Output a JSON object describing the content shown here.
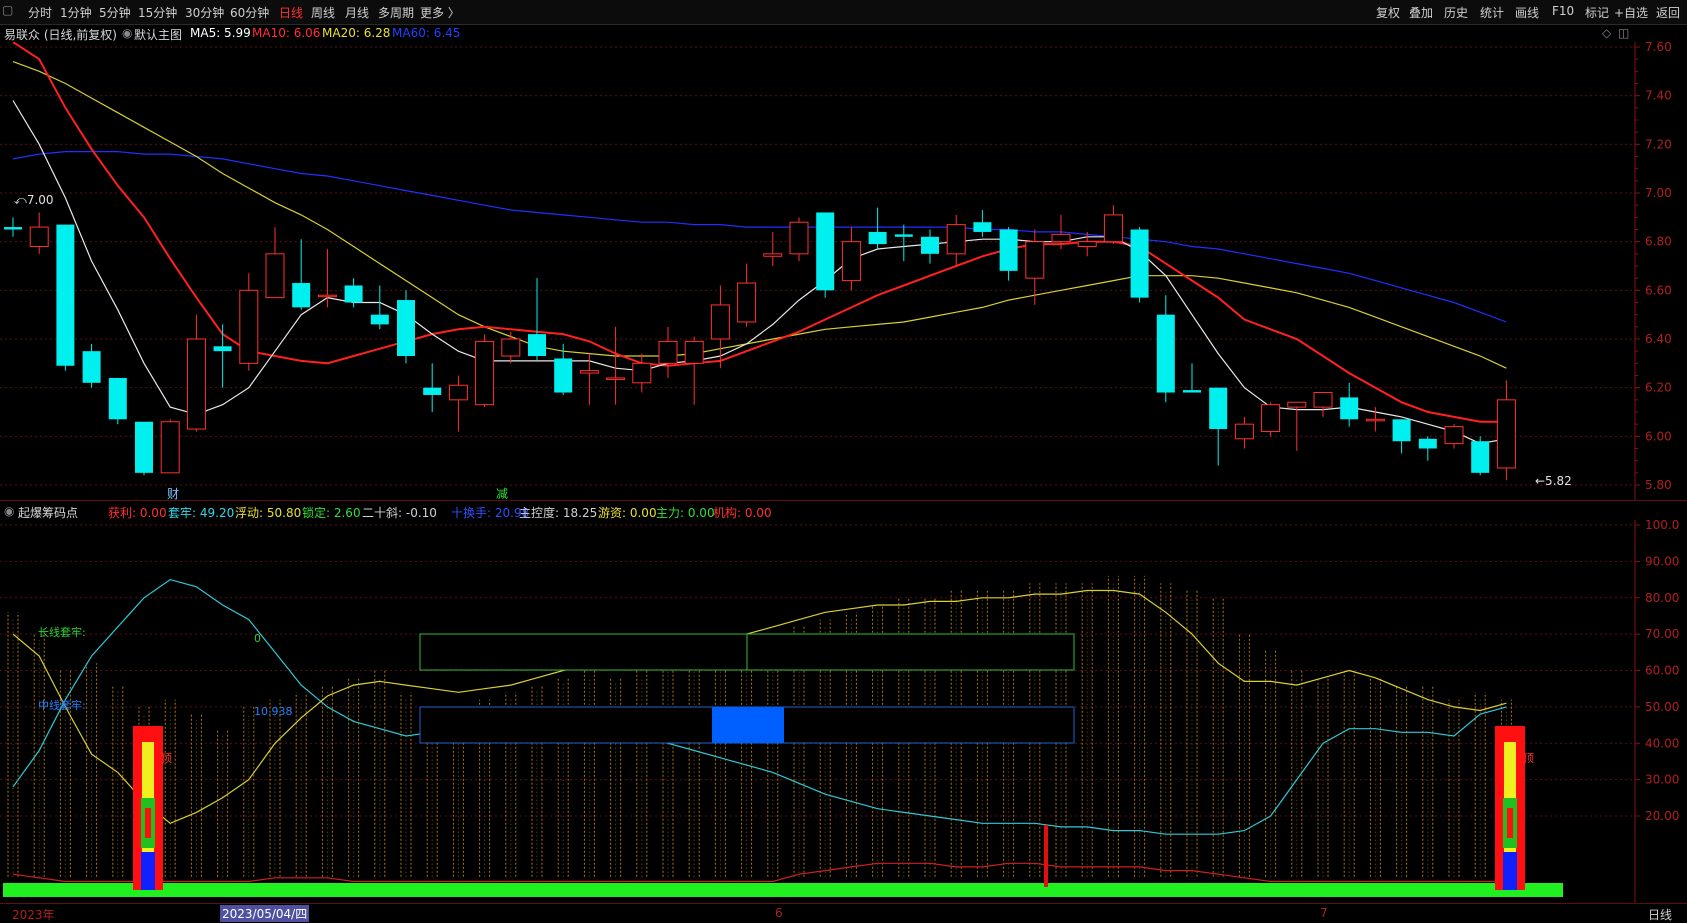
{
  "toolbar": {
    "left_items": [
      "分时",
      "1分钟",
      "5分钟",
      "15分钟",
      "30分钟",
      "60分钟",
      "日线",
      "周线",
      "月线",
      "多周期",
      "更多 〉"
    ],
    "active": "日线",
    "right_items": [
      "复权",
      "叠加",
      "历史",
      "统计",
      "画线",
      "F10",
      "标记",
      "+自选",
      "返回"
    ]
  },
  "main_info": {
    "stock": "易联众 (日线,前复权)",
    "template": "默认主图",
    "ma5": "MA5: 5.99",
    "ma10": "MA10: 6.06",
    "ma20": "MA20: 6.28",
    "ma60": "MA60: 6.45"
  },
  "sub_info": {
    "name": "起爆筹码点",
    "items": [
      {
        "text": "获利: 0.00",
        "color": "#ff3030"
      },
      {
        "text": "套牢: 49.20",
        "color": "#30d8e8"
      },
      {
        "text": "浮动: 50.80",
        "color": "#e8e030"
      },
      {
        "text": "锁定: 2.60",
        "color": "#30e030"
      },
      {
        "text": "二十斜: -0.10",
        "color": "#d0d0d0"
      },
      {
        "text": "十换手: 20.98",
        "color": "#3050ff"
      },
      {
        "text": "主控度: 18.25",
        "color": "#d0d0d0"
      },
      {
        "text": "游资: 0.00",
        "color": "#e8e030"
      },
      {
        "text": "主力: 0.00",
        "color": "#30e030"
      },
      {
        "text": "机构: 0.00",
        "color": "#ff3030"
      }
    ],
    "long_label": "长线套牢:",
    "long_value": "0",
    "mid_label": "中线套牢:",
    "mid_value": "10.938"
  },
  "price_axis": [
    "7.60",
    "7.40",
    "7.20",
    "7.00",
    "6.80",
    "6.60",
    "6.40",
    "6.20",
    "6.00",
    "5.80"
  ],
  "sub_axis": [
    "100.0",
    "90.00",
    "80.00",
    "70.00",
    "60.00",
    "50.00",
    "40.00",
    "30.00",
    "20.00"
  ],
  "annotations": {
    "high": "7.00",
    "low": "5.82",
    "event1": "财",
    "event2": "减",
    "sig1": "顶",
    "sig2": "顶"
  },
  "bottom": {
    "year": "2023年",
    "date": "2023/05/04/四",
    "m6": "6",
    "m7": "7",
    "period": "日线"
  },
  "colors": {
    "up": "#ff3030",
    "down": "#00f0f0",
    "ma5": "#ffffff",
    "ma10": "#ff2020",
    "ma20": "#e0e030",
    "ma60": "#2030ff"
  },
  "chart_data": {
    "type": "candlestick",
    "ylim": [
      5.75,
      7.65
    ],
    "candles": [
      {
        "o": 6.86,
        "h": 6.9,
        "l": 6.82,
        "c": 6.85
      },
      {
        "o": 6.78,
        "h": 6.92,
        "l": 6.75,
        "c": 6.86
      },
      {
        "o": 6.87,
        "h": 6.87,
        "l": 6.27,
        "c": 6.29
      },
      {
        "o": 6.35,
        "h": 6.38,
        "l": 6.2,
        "c": 6.22
      },
      {
        "o": 6.24,
        "h": 6.24,
        "l": 6.05,
        "c": 6.07
      },
      {
        "o": 6.06,
        "h": 6.06,
        "l": 5.84,
        "c": 5.85
      },
      {
        "o": 5.85,
        "h": 6.07,
        "l": 5.85,
        "c": 6.06
      },
      {
        "o": 6.03,
        "h": 6.5,
        "l": 6.02,
        "c": 6.4
      },
      {
        "o": 6.37,
        "h": 6.46,
        "l": 6.2,
        "c": 6.35
      },
      {
        "o": 6.3,
        "h": 6.67,
        "l": 6.27,
        "c": 6.6
      },
      {
        "o": 6.57,
        "h": 6.86,
        "l": 6.57,
        "c": 6.75
      },
      {
        "o": 6.63,
        "h": 6.81,
        "l": 6.52,
        "c": 6.53
      },
      {
        "o": 6.58,
        "h": 6.77,
        "l": 6.53,
        "c": 6.58
      },
      {
        "o": 6.62,
        "h": 6.65,
        "l": 6.53,
        "c": 6.55
      },
      {
        "o": 6.5,
        "h": 6.62,
        "l": 6.44,
        "c": 6.46
      },
      {
        "o": 6.56,
        "h": 6.6,
        "l": 6.3,
        "c": 6.33
      },
      {
        "o": 6.2,
        "h": 6.3,
        "l": 6.1,
        "c": 6.17
      },
      {
        "o": 6.15,
        "h": 6.25,
        "l": 6.02,
        "c": 6.21
      },
      {
        "o": 6.13,
        "h": 6.42,
        "l": 6.12,
        "c": 6.39
      },
      {
        "o": 6.33,
        "h": 6.43,
        "l": 6.3,
        "c": 6.4
      },
      {
        "o": 6.42,
        "h": 6.65,
        "l": 6.31,
        "c": 6.33
      },
      {
        "o": 6.32,
        "h": 6.38,
        "l": 6.17,
        "c": 6.18
      },
      {
        "o": 6.26,
        "h": 6.34,
        "l": 6.13,
        "c": 6.27
      },
      {
        "o": 6.24,
        "h": 6.45,
        "l": 6.13,
        "c": 6.24
      },
      {
        "o": 6.22,
        "h": 6.34,
        "l": 6.18,
        "c": 6.3
      },
      {
        "o": 6.3,
        "h": 6.45,
        "l": 6.24,
        "c": 6.39
      },
      {
        "o": 6.3,
        "h": 6.41,
        "l": 6.13,
        "c": 6.39
      },
      {
        "o": 6.4,
        "h": 6.62,
        "l": 6.28,
        "c": 6.54
      },
      {
        "o": 6.47,
        "h": 6.71,
        "l": 6.45,
        "c": 6.63
      },
      {
        "o": 6.74,
        "h": 6.84,
        "l": 6.7,
        "c": 6.75
      },
      {
        "o": 6.75,
        "h": 6.9,
        "l": 6.72,
        "c": 6.88
      },
      {
        "o": 6.92,
        "h": 6.92,
        "l": 6.57,
        "c": 6.6
      },
      {
        "o": 6.64,
        "h": 6.86,
        "l": 6.6,
        "c": 6.8
      },
      {
        "o": 6.84,
        "h": 6.94,
        "l": 6.77,
        "c": 6.79
      },
      {
        "o": 6.83,
        "h": 6.87,
        "l": 6.72,
        "c": 6.82
      },
      {
        "o": 6.82,
        "h": 6.85,
        "l": 6.71,
        "c": 6.75
      },
      {
        "o": 6.75,
        "h": 6.91,
        "l": 6.7,
        "c": 6.87
      },
      {
        "o": 6.88,
        "h": 6.93,
        "l": 6.82,
        "c": 6.84
      },
      {
        "o": 6.85,
        "h": 6.86,
        "l": 6.64,
        "c": 6.68
      },
      {
        "o": 6.65,
        "h": 6.85,
        "l": 6.54,
        "c": 6.8
      },
      {
        "o": 6.8,
        "h": 6.91,
        "l": 6.77,
        "c": 6.83
      },
      {
        "o": 6.78,
        "h": 6.84,
        "l": 6.74,
        "c": 6.8
      },
      {
        "o": 6.8,
        "h": 6.95,
        "l": 6.79,
        "c": 6.91
      },
      {
        "o": 6.85,
        "h": 6.86,
        "l": 6.55,
        "c": 6.57
      },
      {
        "o": 6.5,
        "h": 6.58,
        "l": 6.14,
        "c": 6.18
      },
      {
        "o": 6.19,
        "h": 6.3,
        "l": 6.18,
        "c": 6.18
      },
      {
        "o": 6.2,
        "h": 6.2,
        "l": 5.88,
        "c": 6.03
      },
      {
        "o": 5.99,
        "h": 6.08,
        "l": 5.95,
        "c": 6.05
      },
      {
        "o": 6.02,
        "h": 6.14,
        "l": 6.0,
        "c": 6.13
      },
      {
        "o": 6.12,
        "h": 6.14,
        "l": 5.94,
        "c": 6.14
      },
      {
        "o": 6.12,
        "h": 6.18,
        "l": 6.08,
        "c": 6.18
      },
      {
        "o": 6.16,
        "h": 6.22,
        "l": 6.04,
        "c": 6.07
      },
      {
        "o": 6.07,
        "h": 6.12,
        "l": 6.02,
        "c": 6.07
      },
      {
        "o": 6.07,
        "h": 6.07,
        "l": 5.93,
        "c": 5.98
      },
      {
        "o": 5.99,
        "h": 6.0,
        "l": 5.9,
        "c": 5.95
      },
      {
        "o": 5.97,
        "h": 6.05,
        "l": 5.95,
        "c": 6.04
      },
      {
        "o": 5.98,
        "h": 6.0,
        "l": 5.84,
        "c": 5.85
      },
      {
        "o": 5.87,
        "h": 6.23,
        "l": 5.82,
        "c": 6.15
      }
    ],
    "ma5": [
      7.38,
      7.2,
      6.98,
      6.72,
      6.52,
      6.3,
      6.12,
      6.09,
      6.13,
      6.2,
      6.35,
      6.5,
      6.57,
      6.55,
      6.55,
      6.5,
      6.42,
      6.35,
      6.31,
      6.31,
      6.31,
      6.31,
      6.31,
      6.28,
      6.27,
      6.3,
      6.31,
      6.33,
      6.38,
      6.46,
      6.56,
      6.64,
      6.73,
      6.77,
      6.78,
      6.79,
      6.8,
      6.81,
      6.81,
      6.8,
      6.8,
      6.82,
      6.82,
      6.76,
      6.66,
      6.5,
      6.34,
      6.2,
      6.12,
      6.11,
      6.11,
      6.12,
      6.1,
      6.08,
      6.05,
      6.02,
      5.97,
      5.99
    ],
    "ma10": [
      7.62,
      7.55,
      7.35,
      7.18,
      7.03,
      6.9,
      6.73,
      6.57,
      6.42,
      6.35,
      6.33,
      6.31,
      6.3,
      6.33,
      6.36,
      6.39,
      6.42,
      6.44,
      6.45,
      6.44,
      6.43,
      6.42,
      6.39,
      6.34,
      6.3,
      6.29,
      6.3,
      6.31,
      6.35,
      6.39,
      6.43,
      6.48,
      6.53,
      6.58,
      6.62,
      6.66,
      6.7,
      6.74,
      6.77,
      6.79,
      6.79,
      6.8,
      6.8,
      6.78,
      6.71,
      6.64,
      6.57,
      6.48,
      6.44,
      6.4,
      6.33,
      6.26,
      6.2,
      6.14,
      6.1,
      6.08,
      6.06,
      6.06
    ],
    "ma20": [
      7.54,
      7.5,
      7.45,
      7.39,
      7.33,
      7.27,
      7.21,
      7.15,
      7.08,
      7.02,
      6.96,
      6.91,
      6.85,
      6.78,
      6.71,
      6.64,
      6.57,
      6.5,
      6.45,
      6.41,
      6.37,
      6.35,
      6.34,
      6.33,
      6.33,
      6.33,
      6.34,
      6.36,
      6.38,
      6.4,
      6.42,
      6.44,
      6.45,
      6.46,
      6.47,
      6.49,
      6.51,
      6.53,
      6.56,
      6.58,
      6.6,
      6.62,
      6.64,
      6.66,
      6.66,
      6.66,
      6.65,
      6.63,
      6.61,
      6.59,
      6.56,
      6.53,
      6.49,
      6.45,
      6.41,
      6.37,
      6.33,
      6.28
    ],
    "ma60": [
      7.14,
      7.16,
      7.17,
      7.17,
      7.17,
      7.16,
      7.16,
      7.15,
      7.14,
      7.12,
      7.1,
      7.08,
      7.07,
      7.05,
      7.03,
      7.01,
      6.99,
      6.97,
      6.95,
      6.93,
      6.92,
      6.91,
      6.9,
      6.89,
      6.88,
      6.88,
      6.87,
      6.87,
      6.86,
      6.86,
      6.86,
      6.86,
      6.86,
      6.86,
      6.86,
      6.86,
      6.86,
      6.85,
      6.85,
      6.84,
      6.84,
      6.83,
      6.82,
      6.81,
      6.8,
      6.78,
      6.77,
      6.75,
      6.73,
      6.71,
      6.69,
      6.67,
      6.64,
      6.61,
      6.58,
      6.55,
      6.51,
      6.47
    ],
    "sub_ylim": [
      0,
      105
    ],
    "trapped_line": [
      28,
      38,
      52,
      64,
      72,
      80,
      85,
      83,
      78,
      74,
      65,
      56,
      50,
      46,
      44,
      42,
      43,
      44,
      45,
      46,
      47,
      46,
      45,
      44,
      42,
      40,
      38,
      36,
      34,
      32,
      29,
      26,
      24,
      22,
      21,
      20,
      19,
      18,
      18,
      18,
      17,
      17,
      16,
      16,
      15,
      15,
      15,
      16,
      20,
      30,
      40,
      44,
      44,
      43,
      43,
      42,
      48,
      50
    ],
    "floating_line": [
      70,
      64,
      50,
      37,
      32,
      24,
      18,
      21,
      25,
      30,
      40,
      47,
      53,
      56,
      57,
      56,
      55,
      54,
      55,
      56,
      58,
      60,
      62,
      62,
      63,
      64,
      66,
      68,
      70,
      72,
      74,
      76,
      77,
      78,
      78,
      79,
      79,
      80,
      80,
      81,
      81,
      82,
      82,
      81,
      76,
      70,
      62,
      57,
      57,
      56,
      58,
      60,
      58,
      55,
      52,
      50,
      49,
      51
    ],
    "profit_line": [
      4,
      3,
      2,
      2,
      2,
      2,
      2,
      2,
      2,
      2,
      3,
      3,
      3,
      2,
      2,
      2,
      2,
      2,
      2,
      2,
      2,
      2,
      2,
      2,
      2,
      2,
      2,
      2,
      2,
      2,
      4,
      5,
      6,
      7,
      7,
      7,
      6,
      6,
      7,
      7,
      6,
      6,
      6,
      6,
      5,
      5,
      4,
      3,
      2,
      2,
      2,
      2,
      2,
      2,
      2,
      2,
      2,
      2
    ],
    "volume_bars": [
      76,
      70,
      60,
      62,
      56,
      50,
      52,
      48,
      44,
      50,
      52,
      54,
      56,
      58,
      60,
      54,
      50,
      50,
      52,
      54,
      56,
      58,
      60,
      58,
      60,
      62,
      64,
      66,
      68,
      70,
      72,
      74,
      76,
      78,
      80,
      80,
      82,
      82,
      82,
      84,
      84,
      84,
      86,
      86,
      84,
      82,
      80,
      70,
      66,
      60,
      58,
      60,
      58,
      56,
      56,
      52,
      54,
      52
    ]
  }
}
